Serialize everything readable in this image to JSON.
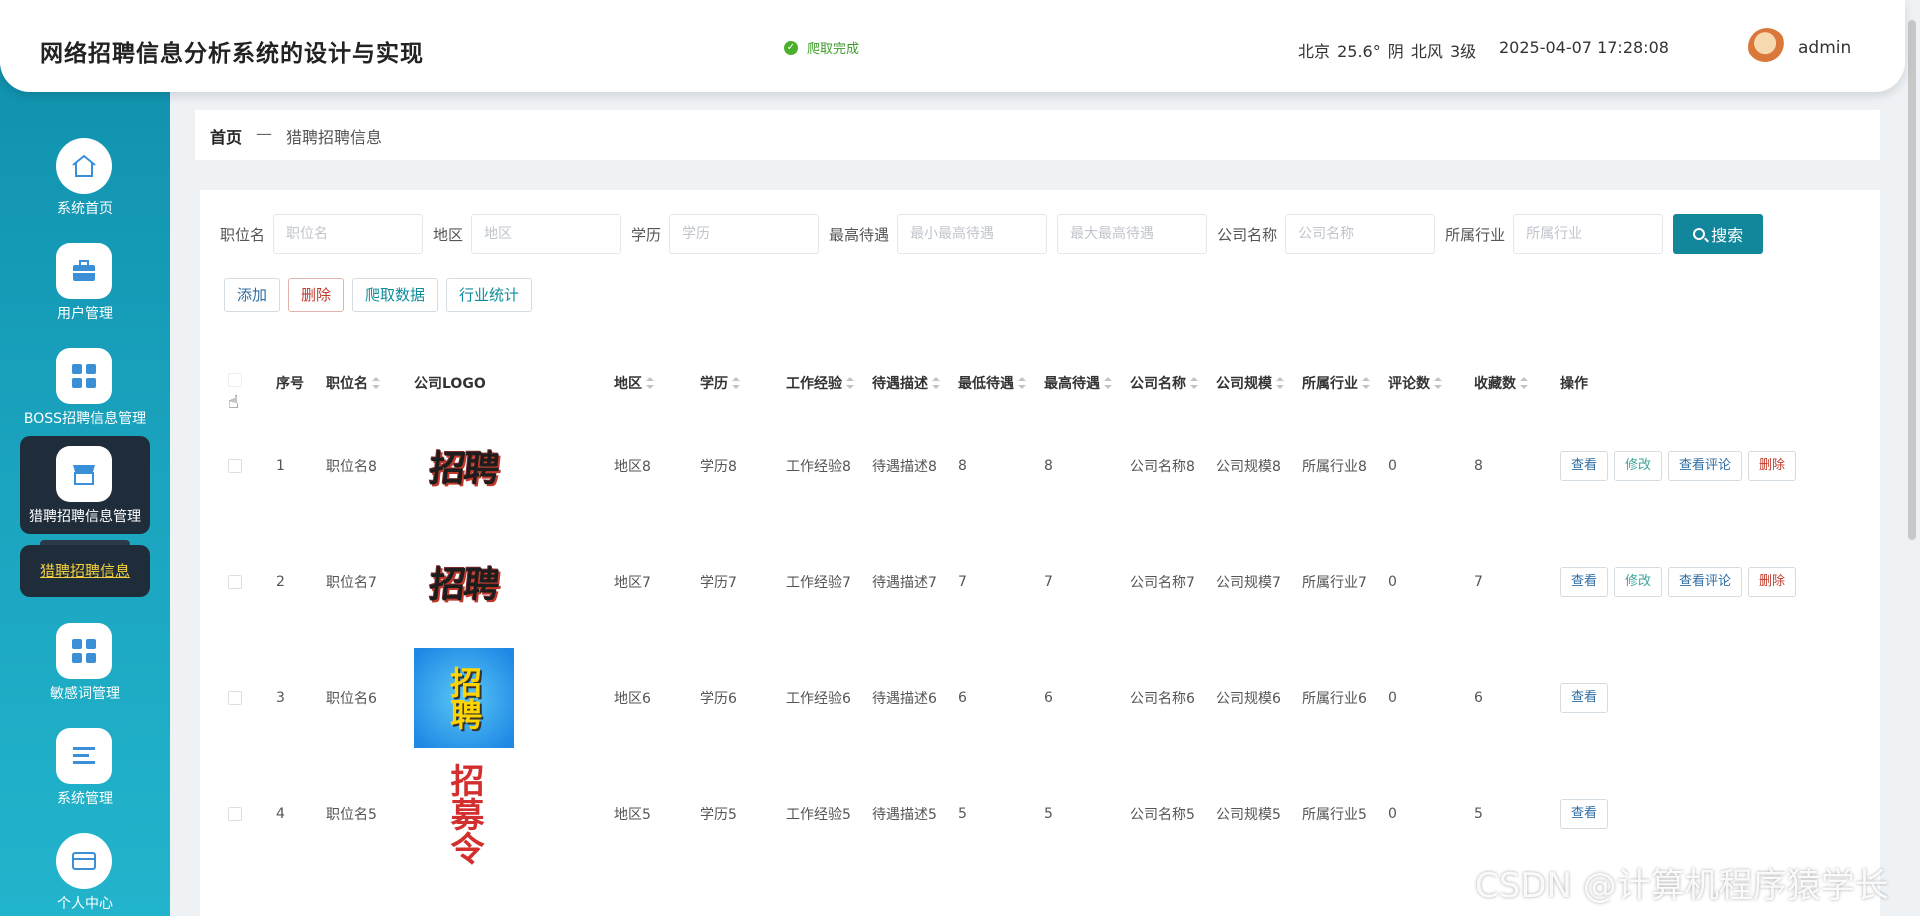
{
  "header": {
    "title": "网络招聘信息分析系统的设计与实现",
    "status": "爬取完成",
    "weather": "北京 25.6° 阴 北风 3级",
    "datetime": "2025-04-07 17:28:08",
    "username": "admin"
  },
  "sidebar": {
    "items": [
      {
        "label": "系统首页",
        "icon": "home-icon"
      },
      {
        "label": "用户管理",
        "icon": "briefcase-icon"
      },
      {
        "label": "BOSS招聘信息管理",
        "icon": "grid-icon"
      },
      {
        "label": "猎聘招聘信息管理",
        "icon": "store-icon"
      },
      {
        "label": "敏感词管理",
        "icon": "grid-icon"
      },
      {
        "label": "系统管理",
        "icon": "list-icon"
      },
      {
        "label": "个人中心",
        "icon": "card-icon"
      }
    ],
    "sub_item": "猎聘招聘信息"
  },
  "breadcrumb": {
    "home": "首页",
    "sep": "—",
    "current": "猎聘招聘信息"
  },
  "search": {
    "job_label": "职位名",
    "job_placeholder": "职位名",
    "area_label": "地区",
    "area_placeholder": "地区",
    "edu_label": "学历",
    "edu_placeholder": "学历",
    "salary_label": "最高待遇",
    "salary_min_placeholder": "最小最高待遇",
    "salary_max_placeholder": "最大最高待遇",
    "company_label": "公司名称",
    "company_placeholder": "公司名称",
    "industry_label": "所属行业",
    "industry_placeholder": "所属行业",
    "button": "搜索"
  },
  "actions": {
    "add": "添加",
    "delete": "删除",
    "crawl": "爬取数据",
    "stats": "行业统计"
  },
  "table": {
    "headers": [
      "序号",
      "职位名",
      "公司LOGO",
      "地区",
      "学历",
      "工作经验",
      "待遇描述",
      "最低待遇",
      "最高待遇",
      "公司名称",
      "公司规模",
      "所属行业",
      "评论数",
      "收藏数",
      "操作"
    ],
    "op_labels": {
      "view": "查看",
      "edit": "修改",
      "review": "查看评论",
      "delete": "删除"
    },
    "rows": [
      {
        "idx": "1",
        "job": "职位名8",
        "logo": "招聘",
        "area": "地区8",
        "edu": "学历8",
        "exp": "工作经验8",
        "desc": "待遇描述8",
        "min": "8",
        "max": "8",
        "company": "公司名称8",
        "size": "公司规模8",
        "industry": "所属行业8",
        "comments": "0",
        "favs": "8"
      },
      {
        "idx": "2",
        "job": "职位名7",
        "logo": "招聘",
        "area": "地区7",
        "edu": "学历7",
        "exp": "工作经验7",
        "desc": "待遇描述7",
        "min": "7",
        "max": "7",
        "company": "公司名称7",
        "size": "公司规模7",
        "industry": "所属行业7",
        "comments": "0",
        "favs": "7"
      },
      {
        "idx": "3",
        "job": "职位名6",
        "logo": "招聘",
        "area": "地区6",
        "edu": "学历6",
        "exp": "工作经验6",
        "desc": "待遇描述6",
        "min": "6",
        "max": "6",
        "company": "公司名称6",
        "size": "公司规模6",
        "industry": "所属行业6",
        "comments": "0",
        "favs": "6"
      },
      {
        "idx": "4",
        "job": "职位名5",
        "logo": "招募令",
        "area": "地区5",
        "edu": "学历5",
        "exp": "工作经验5",
        "desc": "待遇描述5",
        "min": "5",
        "max": "5",
        "company": "公司名称5",
        "size": "公司规模5",
        "industry": "所属行业5",
        "comments": "0",
        "favs": "5"
      }
    ]
  },
  "watermark": "CSDN @计算机程序猿学长",
  "colors": {
    "sidebar": "#1aa3be",
    "primary": "#12879b",
    "active_nav": "#1f2d3b",
    "sub_text": "#f4d03f",
    "status_ok": "#4caf2c"
  }
}
